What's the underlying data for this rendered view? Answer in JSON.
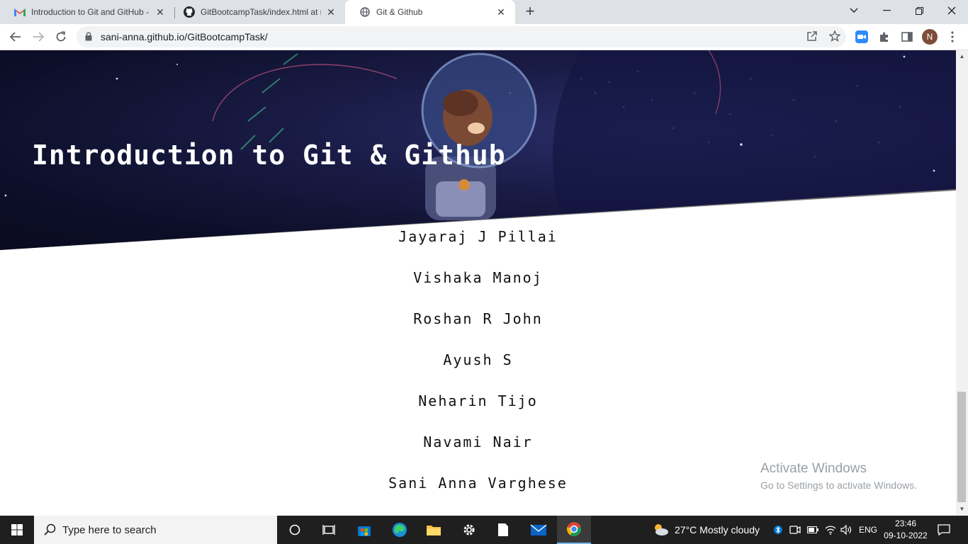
{
  "browser": {
    "tabs": [
      {
        "title": "Introduction to Git and GitHub -",
        "favicon": "gmail-icon",
        "active": false
      },
      {
        "title": "GitBootcampTask/index.html at m",
        "favicon": "github-icon",
        "active": false
      },
      {
        "title": "Git & Github",
        "favicon": "globe-icon",
        "active": true
      }
    ],
    "url": "sani-anna.github.io/GitBootcampTask/",
    "profile_initial": "N"
  },
  "page": {
    "hero_title": "Introduction to Git & Github",
    "names": [
      "Jayaraj J Pillai",
      "Vishaka Manoj",
      "Roshan R John",
      "Ayush S",
      "Neharin Tijo",
      "Navami Nair",
      "Sani Anna Varghese"
    ]
  },
  "watermark": {
    "line1": "Activate Windows",
    "line2": "Go to Settings to activate Windows."
  },
  "taskbar": {
    "search_placeholder": "Type here to search",
    "weather": "27°C  Mostly cloudy",
    "language": "ENG",
    "time": "23:46",
    "date": "09-10-2022"
  },
  "colors": {
    "hero_bg": "#0d0f2a",
    "tabstrip": "#dee1e6",
    "taskbar": "#1f1f1f"
  }
}
